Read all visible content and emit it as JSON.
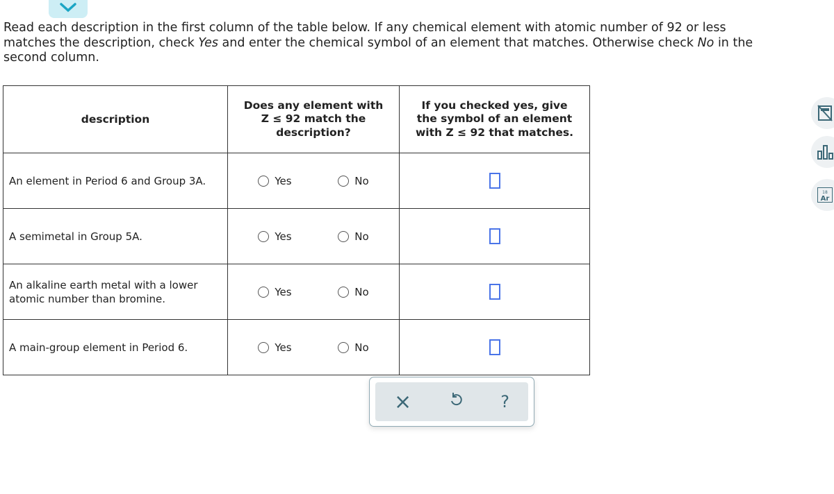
{
  "prompt": {
    "part1": "Read each description in the first column of the table below. If any chemical element with atomic number of 92 or less matches the description, check ",
    "yes": "Yes",
    "part2": " and enter the chemical symbol of an element that matches. Otherwise check ",
    "no": "No",
    "part3": " in the second column."
  },
  "table": {
    "headers": [
      "description",
      "Does any element with Z ≤ 92 match the description?",
      "If you checked yes, give the symbol of an element with Z ≤ 92 that matches."
    ],
    "rows": [
      {
        "description": "An element in Period 6 and Group 3A.",
        "yes": "Yes",
        "no": "No",
        "symbol": ""
      },
      {
        "description": "A semimetal in Group 5A.",
        "yes": "Yes",
        "no": "No",
        "symbol": ""
      },
      {
        "description": "An alkaline earth metal with a lower atomic number than bromine.",
        "yes": "Yes",
        "no": "No",
        "symbol": ""
      },
      {
        "description": "A main-group element in Period 6.",
        "yes": "Yes",
        "no": "No",
        "symbol": ""
      }
    ]
  },
  "actions": {
    "clear": "×",
    "undo": "undo-icon",
    "help": "?"
  },
  "sidebar": {
    "periodic_number": "18",
    "periodic_symbol": "Ar"
  }
}
